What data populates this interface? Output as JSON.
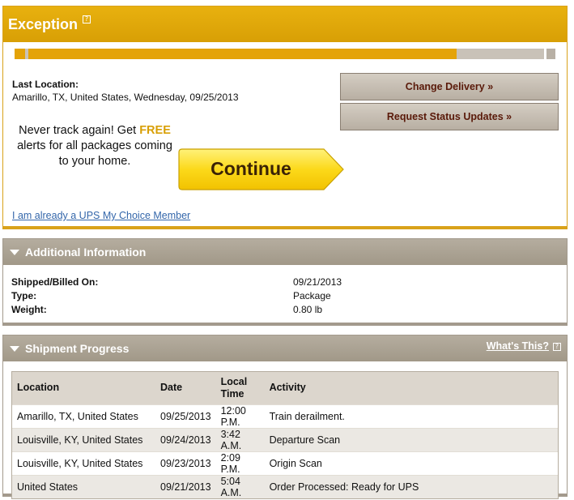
{
  "exception": {
    "title": "Exception",
    "help_symbol": "?",
    "progress_fraction": 0.83,
    "last_location_label": "Last Location:",
    "last_location_value": "Amarillo, TX, United States, Wednesday, 09/25/2013",
    "change_delivery_label": "Change Delivery »",
    "request_updates_label": "Request Status Updates »",
    "promo_prefix": "Never track again! Get ",
    "promo_free": "FREE",
    "promo_suffix": "alerts for all packages coming to your home.",
    "continue_label": "Continue",
    "member_link": "I am already a UPS My Choice Member"
  },
  "additional": {
    "title": "Additional Information",
    "rows": [
      {
        "label": "Shipped/Billed On:",
        "value": "09/21/2013"
      },
      {
        "label": "Type:",
        "value": "Package"
      },
      {
        "label": "Weight:",
        "value": "0.80 lb"
      }
    ]
  },
  "shipment": {
    "title": "Shipment Progress",
    "whats_this": "What's This?",
    "help_symbol": "?",
    "columns": [
      "Location",
      "Date",
      "Local Time",
      "Activity"
    ],
    "rows": [
      [
        "Amarillo, TX, United States",
        "09/25/2013",
        "12:00 P.M.",
        "Train derailment."
      ],
      [
        "Louisville, KY, United States",
        "09/24/2013",
        "3:42 A.M.",
        "Departure Scan"
      ],
      [
        "Louisville, KY, United States",
        "09/23/2013",
        "2:09 P.M.",
        "Origin Scan"
      ],
      [
        "United States",
        "09/21/2013",
        "5:04 A.M.",
        "Order Processed: Ready for UPS"
      ]
    ]
  },
  "colors": {
    "accent_gold": "#d89f05",
    "panel_gray": "#a19888",
    "link_blue": "#3366aa",
    "button_text": "#5a1a0a"
  }
}
